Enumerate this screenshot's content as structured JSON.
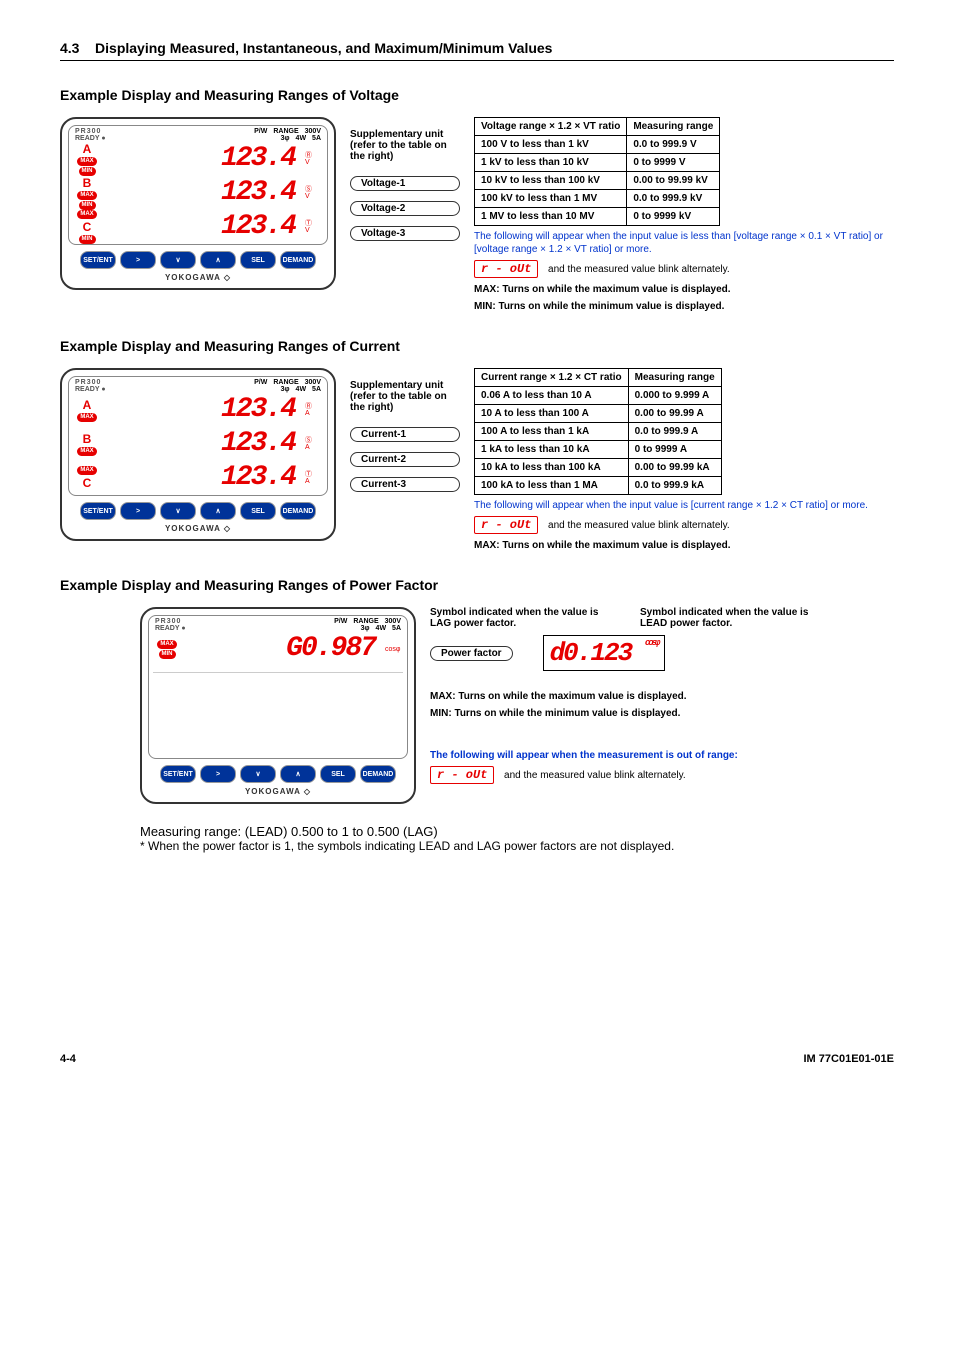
{
  "header": {
    "section_num": "4.3",
    "section_title": "Displaying Measured, Instantaneous, and Maximum/Minimum Values"
  },
  "voltage": {
    "heading": "Example Display and Measuring Ranges of Voltage",
    "sup_unit": "Supplementary unit (refer to the table on the right)",
    "device": {
      "model": "PR300",
      "pw": "P/W",
      "phase": "3φ",
      "wire": "4W",
      "range_lbl": "RANGE",
      "vr": "300V",
      "cr": "5A",
      "ready": "READY ●",
      "yokogawa": "YOKOGAWA ◇",
      "rowA_label": "A",
      "rowA_max": "MAX",
      "rowA_min": "MIN",
      "rowA_digits": "123.4",
      "rowA_circ": "Ⓡ",
      "rowA_unit": "V",
      "rowB_label": "B",
      "rowB_max": "MAX",
      "rowB_min": "MIN",
      "rowB_digits": "123.4",
      "rowB_circ": "Ⓢ",
      "rowB_unit": "V",
      "rowC_label": "C",
      "rowC_max": "MAX",
      "rowC_min": "MIN",
      "rowC_digits": "123.4",
      "rowC_circ": "Ⓣ",
      "rowC_unit": "V",
      "btn_set": "SET/ENT",
      "btn_next": ">",
      "btn_down": "∨",
      "btn_up": "∧",
      "btn_sel": "SEL",
      "btn_demand": "DEMAND"
    },
    "callouts": {
      "v1": "Voltage-1",
      "v2": "Voltage-2",
      "v3": "Voltage-3"
    },
    "table_headers": {
      "c1": "Voltage range × 1.2 × VT ratio",
      "c2": "Measuring range"
    },
    "table": [
      {
        "a": "100 V to less than 1 kV",
        "b": "0.0 to 999.9 V"
      },
      {
        "a": "1 kV to less than 10 kV",
        "b": "0 to 9999 V"
      },
      {
        "a": "10 kV to less than 100 kV",
        "b": "0.00 to 99.99 kV"
      },
      {
        "a": "100 kV to less than 1 MV",
        "b": "0.0 to 999.9 kV"
      },
      {
        "a": "1 MV to less than 10 MV",
        "b": "0 to 9999 kV"
      }
    ],
    "note1": "The following will appear when the input value is less than [voltage range × 0.1 × VT ratio] or [voltage range × 1.2 × VT ratio] or more.",
    "rout": "r - oUt",
    "note_blink": "and the measured value blink alternately.",
    "max_note": ": Turns on while the maximum value is displayed.",
    "min_note": ": Turns on while the minimum value is displayed.",
    "max_sym": "MAX",
    "min_sym": "MIN"
  },
  "current": {
    "heading": "Example Display and Measuring Ranges of Current",
    "sup_unit": "Supplementary unit (refer to the table on the right)",
    "callouts": {
      "c1": "Current-1",
      "c2": "Current-2",
      "c3": "Current-3"
    },
    "table_headers": {
      "c1": "Current range × 1.2 × CT ratio",
      "c2": "Measuring range"
    },
    "table": [
      {
        "a": "0.06 A to less than 10 A",
        "b": "0.000 to 9.999 A"
      },
      {
        "a": "10 A to less than 100 A",
        "b": "0.00 to 99.99 A"
      },
      {
        "a": "100 A to less than 1 kA",
        "b": "0.0 to 999.9 A"
      },
      {
        "a": "1 kA to less than 10 kA",
        "b": "0 to 9999 A"
      },
      {
        "a": "10 kA to less than 100 kA",
        "b": "0.00 to 99.99 kA"
      },
      {
        "a": "100 kA to less than 1 MA",
        "b": "0.0 to 999.9 kA"
      }
    ],
    "note1": "The following will appear when the input value is [current range × 1.2 × CT ratio] or more.",
    "rout": "r - oUt",
    "note_blink": "and the measured value blink alternately.",
    "max_note": ": Turns on while the maximum value is displayed.",
    "max_sym": "MAX",
    "device": {
      "rowA_unit": "A",
      "rowB_unit": "A",
      "rowC_unit": "A",
      "rowA_digits": "123.4",
      "rowB_digits": "123.4",
      "rowC_digits": "123.4",
      "rowA_circ": "Ⓡ",
      "rowB_circ": "Ⓢ",
      "rowC_circ": "Ⓣ"
    }
  },
  "pf": {
    "heading": "Example Display and Measuring Ranges of Power Factor",
    "lag_text": "Symbol indicated when the value is LAG power factor.",
    "lead_text": "Symbol indicated when the value is LEAD power factor.",
    "callout": "Power factor",
    "cos": "cosφ",
    "lag_digits": "G0.987",
    "lead_digits": "d0.123",
    "max_note": ": Turns on while the maximum value is displayed.",
    "min_note": ": Turns on while the minimum value is displayed.",
    "max_sym": "MAX",
    "min_sym": "MIN",
    "out_text": "The following will appear when the measurement is out of range:",
    "rout": "r - oUt",
    "note_blink": "and the measured value blink alternately.",
    "range": "Measuring range: (LEAD) 0.500 to  1  to 0.500 (LAG)",
    "footnote": "* When the power factor is 1, the symbols indicating LEAD and LAG power factors are not displayed."
  },
  "footer": {
    "page": "4-4",
    "doc": "IM 77C01E01-01E"
  }
}
